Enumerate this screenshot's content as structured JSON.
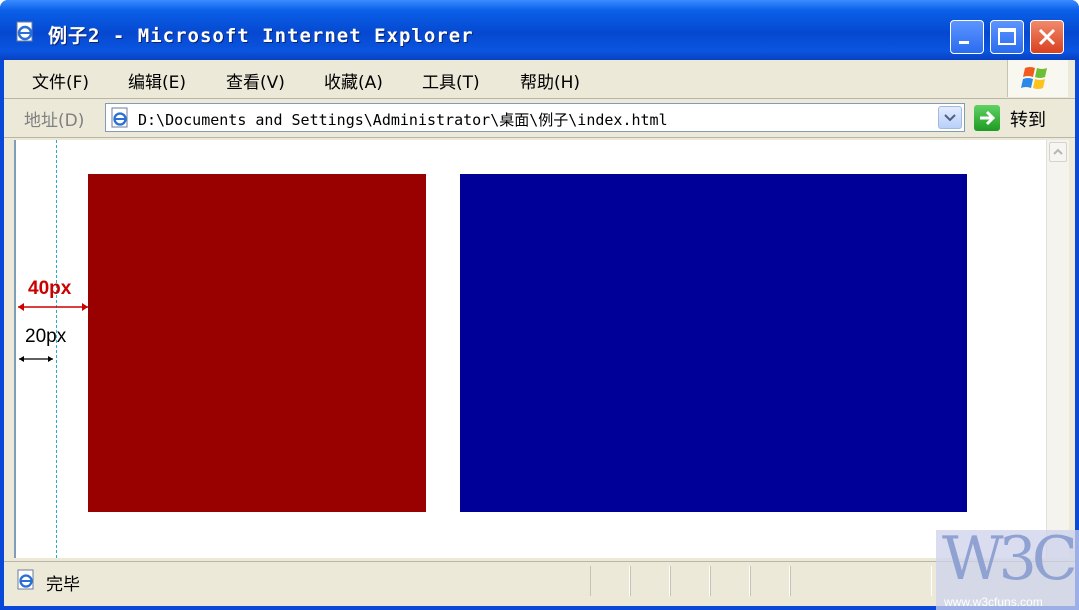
{
  "window": {
    "title": "例子2 - Microsoft Internet Explorer"
  },
  "menu": {
    "items": [
      {
        "label": "文件(F)"
      },
      {
        "label": "编辑(E)"
      },
      {
        "label": "查看(V)"
      },
      {
        "label": "收藏(A)"
      },
      {
        "label": "工具(T)"
      },
      {
        "label": "帮助(H)"
      }
    ]
  },
  "address": {
    "label": "地址(D)",
    "value": "D:\\Documents and Settings\\Administrator\\桌面\\例子\\index.html",
    "go_label": "转到"
  },
  "page": {
    "dim_outer_label": "40px",
    "dim_inner_label": "20px",
    "boxes": [
      {
        "color": "#990000"
      },
      {
        "color": "#000099"
      }
    ]
  },
  "status": {
    "text": "完毕"
  },
  "watermark": {
    "logo": "W3C",
    "url": "www.w3cfuns.com"
  },
  "colors": {
    "titlebar": "#0a48d8",
    "chrome": "#ece9d8",
    "guide": "#21b2c7",
    "dim_outer": "#cc0000"
  }
}
